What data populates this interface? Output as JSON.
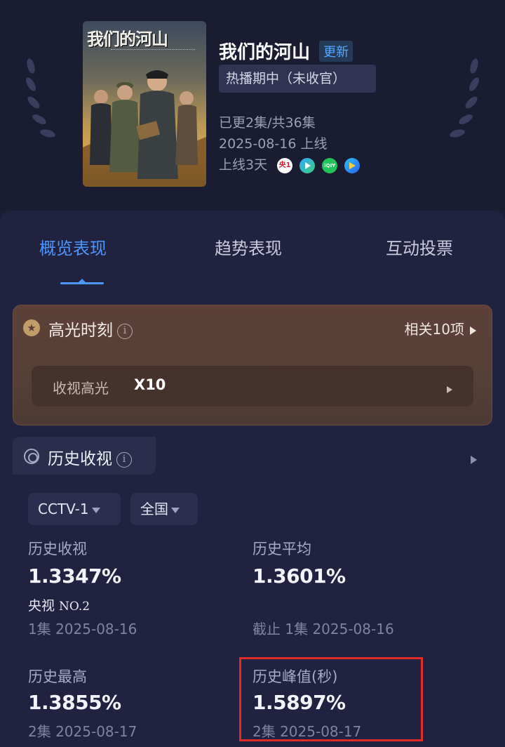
{
  "header": {
    "poster_title": "我们的河山",
    "title": "我们的河山",
    "update_badge": "更新",
    "status": "热播期中（未收官）",
    "episodes": "已更2集/共36集",
    "release": "2025-08-16 上线",
    "days_online": "上线3天",
    "platforms": [
      {
        "name": "cctv-icon",
        "label": "央1",
        "color": "#ffffff"
      },
      {
        "name": "tencent-video-icon",
        "label": "",
        "color": "#2fa8ff"
      },
      {
        "name": "iqiyi-icon",
        "label": "iQIY",
        "color": "#20c25a"
      },
      {
        "name": "youku-icon",
        "label": "",
        "color": "#2e7cf0"
      }
    ]
  },
  "tabs": [
    {
      "label": "概览表现",
      "active": true
    },
    {
      "label": "趋势表现",
      "active": false
    },
    {
      "label": "互动投票",
      "active": false
    }
  ],
  "highlight": {
    "title": "高光时刻",
    "related": "相关10项",
    "item_label": "收视高光",
    "item_value": "X10"
  },
  "history": {
    "title": "历史收视",
    "channel": "CCTV-1",
    "region": "全国",
    "stats": {
      "rating": {
        "label": "历史收视",
        "value": "1.3347%",
        "rank_prefix": "央视 ",
        "rank": "NO.2",
        "sub": "1集 2025-08-16"
      },
      "average": {
        "label": "历史平均",
        "value": "1.3601%",
        "sub": "截止 1集 2025-08-16"
      },
      "max": {
        "label": "历史最高",
        "value": "1.3855%",
        "sub": "2集 2025-08-17"
      },
      "peak": {
        "label": "历史峰值(秒)",
        "value": "1.5897%",
        "sub": "2集 2025-08-17"
      }
    }
  },
  "colors": {
    "accent": "#4d95ff",
    "highlight_card": "#574036",
    "annotation": "#e02a2a"
  }
}
